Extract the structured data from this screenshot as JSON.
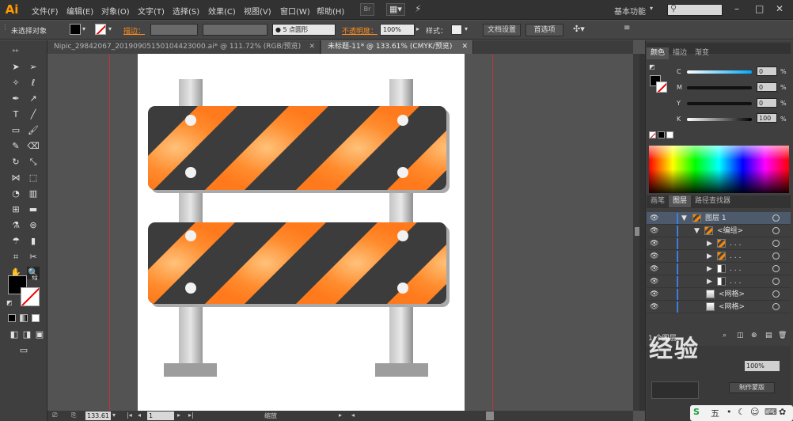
{
  "app": {
    "logo": "Ai"
  },
  "menu": [
    "文件(F)",
    "编辑(E)",
    "对象(O)",
    "文字(T)",
    "选择(S)",
    "效果(C)",
    "视图(V)",
    "窗口(W)",
    "帮助(H)"
  ],
  "menu_buttons": {
    "bridge": "Br"
  },
  "workspace": {
    "label": "基本功能",
    "search_placeholder": ""
  },
  "control_bar": {
    "selection_label": "未选择对象",
    "stroke_label": "描边：",
    "brush_value": "5 点圆形",
    "opacity_label": "不透明度：",
    "opacity_value": "100%",
    "style_label": "样式：",
    "doc_setup_button": "文档设置",
    "preferences_button": "首选项"
  },
  "tabs": [
    {
      "label": "Nipic_29842067_20190905150104423000.ai* @ 111.72% (RGB/预览)",
      "active": false
    },
    {
      "label": "未标题-11* @ 133.61% (CMYK/预览)",
      "active": true
    }
  ],
  "status": {
    "zoom": "133.61",
    "page": "1",
    "tool_label": "缩放"
  },
  "color_panel": {
    "tabs": [
      "颜色",
      "描边",
      "渐变"
    ],
    "channels": [
      {
        "name": "C",
        "value": "0"
      },
      {
        "name": "M",
        "value": "0"
      },
      {
        "name": "Y",
        "value": "0"
      },
      {
        "name": "K",
        "value": "100"
      }
    ],
    "unit": "%"
  },
  "layers_panel": {
    "tabs": [
      "画笔",
      "图层",
      "路径查找器"
    ],
    "rows": [
      {
        "name": "图层 1",
        "indent": 0,
        "expand": "▼"
      },
      {
        "name": "<编组>",
        "indent": 1,
        "expand": "▼"
      },
      {
        "name": ". . .",
        "indent": 2,
        "expand": "▶"
      },
      {
        "name": ". . .",
        "indent": 2,
        "expand": "▶"
      },
      {
        "name": ". . .",
        "indent": 2,
        "expand": "▶"
      },
      {
        "name": ". . .",
        "indent": 2,
        "expand": "▶"
      },
      {
        "name": "<网格>",
        "indent": 2,
        "expand": ""
      },
      {
        "name": "<网格>",
        "indent": 2,
        "expand": ""
      }
    ],
    "footer": "1 个图层"
  },
  "transparency_panel": {
    "opacity_value": "100%",
    "make_mask_button": "制作蒙版"
  },
  "watermark": "经验",
  "taskbar": {
    "ime_label": "五"
  },
  "colors": {
    "accent": "#ff9a00",
    "stripe_orange": "#ff7f24",
    "stripe_dark": "#3c3c3c",
    "guide": "#c0353b"
  }
}
